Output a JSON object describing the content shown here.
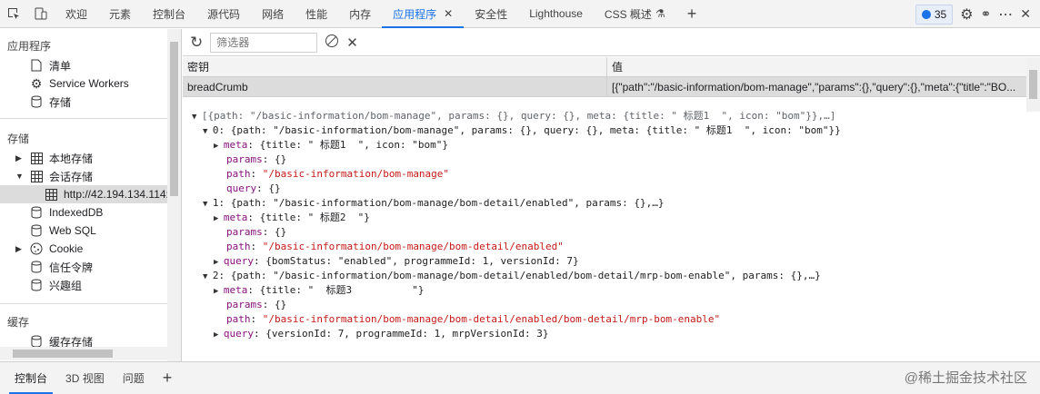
{
  "toolbar_tabs": {
    "welcome": "欢迎",
    "elements": "元素",
    "console": "控制台",
    "sources": "源代码",
    "network": "网络",
    "performance": "性能",
    "memory": "内存",
    "application": "应用程序",
    "security": "安全性",
    "lighthouse": "Lighthouse",
    "css_overview": "CSS 概述"
  },
  "issues_count": "35",
  "sidebar": {
    "app_header": "应用程序",
    "manifest": "清单",
    "service_workers": "Service Workers",
    "storage_overview": "存储",
    "storage_header": "存储",
    "local_storage": "本地存储",
    "session_storage": "会话存储",
    "session_origin": "http://42.194.134.114:",
    "indexeddb": "IndexedDB",
    "websql": "Web SQL",
    "cookie": "Cookie",
    "trust_tokens": "信任令牌",
    "interest_groups": "兴趣组",
    "cache_header": "缓存",
    "cache_storage": "缓存存储"
  },
  "filter": {
    "placeholder": "筛选器"
  },
  "table": {
    "key_header": "密钥",
    "value_header": "值",
    "row_key": "breadCrumb",
    "row_value": "[{\"path\":\"/basic-information/bom-manage\",\"params\":{},\"query\":{},\"meta\":{\"title\":\"BO..."
  },
  "preview": {
    "l0": "[{path: \"/basic-information/bom-manage\", params: {}, query: {}, meta: {title: \" 标题1  \", icon: \"bom\"}},…]",
    "l1": "0: {path: \"/basic-information/bom-manage\", params: {}, query: {}, meta: {title: \" 标题1  \", icon: \"bom\"}}",
    "l2_key": "meta",
    "l2_val": "{title: \" 标题1  \", icon: \"bom\"}",
    "l3_key": "params",
    "l3_val": "{}",
    "l4_key": "path",
    "l4_val": "\"/basic-information/bom-manage\"",
    "l5_key": "query",
    "l5_val": "{}",
    "l6": "1: {path: \"/basic-information/bom-manage/bom-detail/enabled\", params: {},…}",
    "l7_key": "meta",
    "l7_val": "{title: \" 标题2  \"}",
    "l8_key": "params",
    "l8_val": "{}",
    "l9_key": "path",
    "l9_val": "\"/basic-information/bom-manage/bom-detail/enabled\"",
    "l10_key": "query",
    "l10_val": "{bomStatus: \"enabled\", programmeId: 1, versionId: 7}",
    "l11": "2: {path: \"/basic-information/bom-manage/bom-detail/enabled/bom-detail/mrp-bom-enable\", params: {},…}",
    "l12_key": "meta",
    "l12_val": "{title: \"  标题3          \"}",
    "l13_key": "params",
    "l13_val": "{}",
    "l14_key": "path",
    "l14_val": "\"/basic-information/bom-manage/bom-detail/enabled/bom-detail/mrp-bom-enable\"",
    "l15_key": "query",
    "l15_val": "{versionId: 7, programmeId: 1, mrpVersionId: 3}"
  },
  "drawer_tabs": {
    "console": "控制台",
    "view3d": "3D 视图",
    "issues": "问题"
  },
  "watermark": "@稀土掘金技术社区"
}
